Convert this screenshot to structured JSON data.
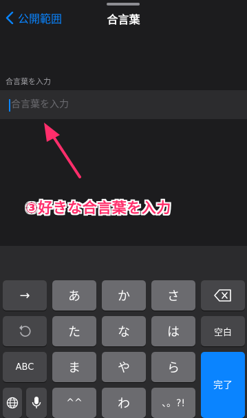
{
  "nav": {
    "back_label": "公開範囲",
    "title": "合言葉"
  },
  "form": {
    "section_label": "合言葉を入力",
    "input_placeholder": "合言葉を入力",
    "input_value": ""
  },
  "annotation": {
    "text": "③好きな合言葉を入力",
    "color": "#ff2e6b"
  },
  "keyboard": {
    "row1": [
      "→",
      "あ",
      "か",
      "さ",
      "delete-icon"
    ],
    "row2": [
      "undo-icon",
      "た",
      "な",
      "は",
      "空白"
    ],
    "row3": [
      "ABC",
      "ま",
      "や",
      "ら"
    ],
    "row4": [
      "globe-icon",
      "mic-icon",
      "^^",
      "わ",
      "、。?!"
    ],
    "keys": {
      "arrow": "→",
      "a": "あ",
      "ka": "か",
      "sa": "さ",
      "ta": "た",
      "na": "な",
      "ha": "は",
      "space": "空白",
      "abc": "ABC",
      "ma": "ま",
      "ya": "や",
      "ra": "ら",
      "hat": "^^",
      "wa": "わ",
      "punct": "、。?!",
      "done": "完了"
    }
  },
  "colors": {
    "accent": "#0a84ff",
    "background": "#1c1c1e",
    "key": "#6b6b6f",
    "func_key": "#464649"
  }
}
